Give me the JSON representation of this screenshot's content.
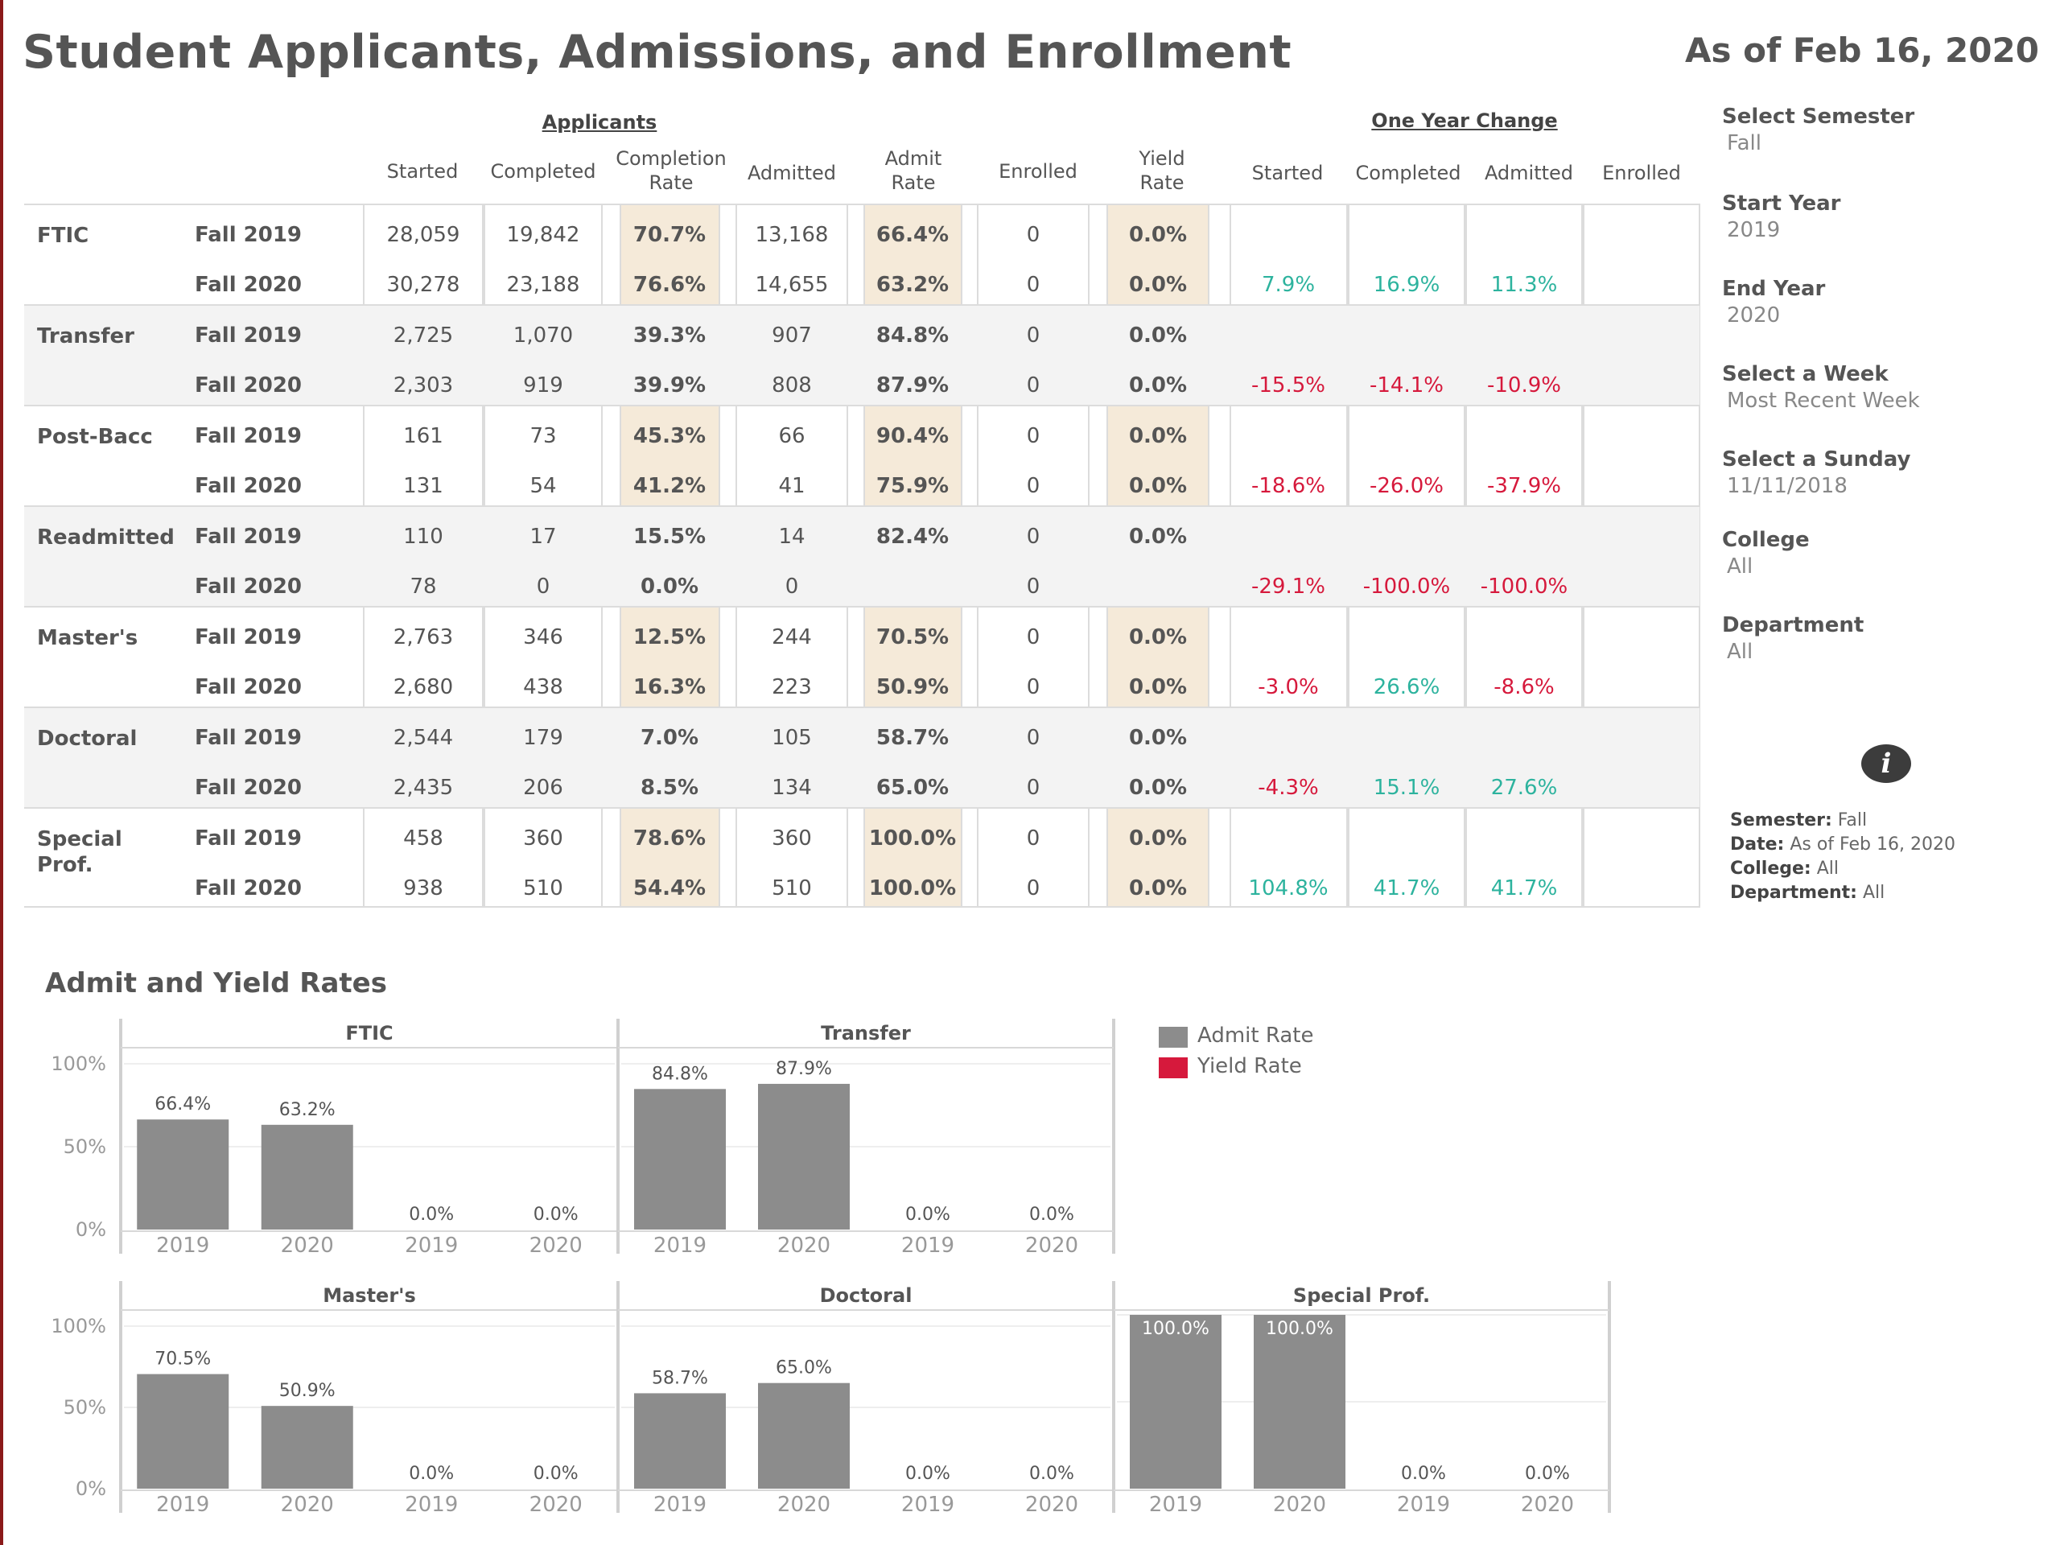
{
  "title": "Student Applicants, Admissions, and Enrollment",
  "as_of": "As of Feb 16, 2020",
  "table": {
    "group_headers": {
      "applicants": "Applicants",
      "change": "One Year Change"
    },
    "headers": {
      "started": "Started",
      "completed": "Completed",
      "completion_rate": "Completion Rate",
      "admitted": "Admitted",
      "admit_rate": "Admit Rate",
      "enrolled": "Enrolled",
      "yield_rate": "Yield Rate",
      "chg_started": "Started",
      "chg_completed": "Completed",
      "chg_admitted": "Admitted",
      "chg_enrolled": "Enrolled"
    },
    "groups": [
      {
        "name": "FTIC",
        "rows": [
          {
            "term": "Fall 2019",
            "started": "28,059",
            "completed": "19,842",
            "completion_rate": "70.7%",
            "admitted": "13,168",
            "admit_rate": "66.4%",
            "enrolled": "0",
            "yield_rate": "0.0%",
            "chg_started": "",
            "chg_completed": "",
            "chg_admitted": ""
          },
          {
            "term": "Fall 2020",
            "started": "30,278",
            "completed": "23,188",
            "completion_rate": "76.6%",
            "admitted": "14,655",
            "admit_rate": "63.2%",
            "enrolled": "0",
            "yield_rate": "0.0%",
            "chg_started": "7.9%",
            "chg_completed": "16.9%",
            "chg_admitted": "11.3%"
          }
        ]
      },
      {
        "name": "Transfer",
        "rows": [
          {
            "term": "Fall 2019",
            "started": "2,725",
            "completed": "1,070",
            "completion_rate": "39.3%",
            "admitted": "907",
            "admit_rate": "84.8%",
            "enrolled": "0",
            "yield_rate": "0.0%",
            "chg_started": "",
            "chg_completed": "",
            "chg_admitted": ""
          },
          {
            "term": "Fall 2020",
            "started": "2,303",
            "completed": "919",
            "completion_rate": "39.9%",
            "admitted": "808",
            "admit_rate": "87.9%",
            "enrolled": "0",
            "yield_rate": "0.0%",
            "chg_started": "-15.5%",
            "chg_completed": "-14.1%",
            "chg_admitted": "-10.9%"
          }
        ]
      },
      {
        "name": "Post-Bacc",
        "rows": [
          {
            "term": "Fall 2019",
            "started": "161",
            "completed": "73",
            "completion_rate": "45.3%",
            "admitted": "66",
            "admit_rate": "90.4%",
            "enrolled": "0",
            "yield_rate": "0.0%",
            "chg_started": "",
            "chg_completed": "",
            "chg_admitted": ""
          },
          {
            "term": "Fall 2020",
            "started": "131",
            "completed": "54",
            "completion_rate": "41.2%",
            "admitted": "41",
            "admit_rate": "75.9%",
            "enrolled": "0",
            "yield_rate": "0.0%",
            "chg_started": "-18.6%",
            "chg_completed": "-26.0%",
            "chg_admitted": "-37.9%"
          }
        ]
      },
      {
        "name": "Readmitted",
        "rows": [
          {
            "term": "Fall 2019",
            "started": "110",
            "completed": "17",
            "completion_rate": "15.5%",
            "admitted": "14",
            "admit_rate": "82.4%",
            "enrolled": "0",
            "yield_rate": "0.0%",
            "chg_started": "",
            "chg_completed": "",
            "chg_admitted": ""
          },
          {
            "term": "Fall 2020",
            "started": "78",
            "completed": "0",
            "completion_rate": "0.0%",
            "admitted": "0",
            "admit_rate": "",
            "enrolled": "0",
            "yield_rate": "",
            "chg_started": "-29.1%",
            "chg_completed": "-100.0%",
            "chg_admitted": "-100.0%"
          }
        ]
      },
      {
        "name": "Master's",
        "rows": [
          {
            "term": "Fall 2019",
            "started": "2,763",
            "completed": "346",
            "completion_rate": "12.5%",
            "admitted": "244",
            "admit_rate": "70.5%",
            "enrolled": "0",
            "yield_rate": "0.0%",
            "chg_started": "",
            "chg_completed": "",
            "chg_admitted": ""
          },
          {
            "term": "Fall 2020",
            "started": "2,680",
            "completed": "438",
            "completion_rate": "16.3%",
            "admitted": "223",
            "admit_rate": "50.9%",
            "enrolled": "0",
            "yield_rate": "0.0%",
            "chg_started": "-3.0%",
            "chg_completed": "26.6%",
            "chg_admitted": "-8.6%"
          }
        ]
      },
      {
        "name": "Doctoral",
        "rows": [
          {
            "term": "Fall 2019",
            "started": "2,544",
            "completed": "179",
            "completion_rate": "7.0%",
            "admitted": "105",
            "admit_rate": "58.7%",
            "enrolled": "0",
            "yield_rate": "0.0%",
            "chg_started": "",
            "chg_completed": "",
            "chg_admitted": ""
          },
          {
            "term": "Fall 2020",
            "started": "2,435",
            "completed": "206",
            "completion_rate": "8.5%",
            "admitted": "134",
            "admit_rate": "65.0%",
            "enrolled": "0",
            "yield_rate": "0.0%",
            "chg_started": "-4.3%",
            "chg_completed": "15.1%",
            "chg_admitted": "27.6%"
          }
        ]
      },
      {
        "name": "Special Prof.",
        "rows": [
          {
            "term": "Fall 2019",
            "started": "458",
            "completed": "360",
            "completion_rate": "78.6%",
            "admitted": "360",
            "admit_rate": "100.0%",
            "enrolled": "0",
            "yield_rate": "0.0%",
            "chg_started": "",
            "chg_completed": "",
            "chg_admitted": ""
          },
          {
            "term": "Fall 2020",
            "started": "938",
            "completed": "510",
            "completion_rate": "54.4%",
            "admitted": "510",
            "admit_rate": "100.0%",
            "enrolled": "0",
            "yield_rate": "0.0%",
            "chg_started": "104.8%",
            "chg_completed": "41.7%",
            "chg_admitted": "41.7%"
          }
        ]
      }
    ]
  },
  "filters": {
    "semester": {
      "label": "Select Semester",
      "value": "Fall"
    },
    "start_year": {
      "label": "Start Year",
      "value": "2019"
    },
    "end_year": {
      "label": "End Year",
      "value": "2020"
    },
    "week": {
      "label": "Select a Week",
      "value": "Most Recent Week"
    },
    "sunday": {
      "label": "Select a Sunday",
      "value": "11/11/2018"
    },
    "college": {
      "label": "College",
      "value": "All"
    },
    "department": {
      "label": "Department",
      "value": "All"
    }
  },
  "info_icon": "info-icon",
  "summary": {
    "semester_label": "Semester:",
    "semester_value": "Fall",
    "date_label": "Date:",
    "date_value": "As of Feb 16, 2020",
    "college_label": "College:",
    "college_value": "All",
    "department_label": "Department:",
    "department_value": "All"
  },
  "chart_section_title": "Admit and Yield Rates",
  "legend": [
    {
      "label": "Admit Rate",
      "color": "#8c8c8c"
    },
    {
      "label": "Yield Rate",
      "color": "#d6193c"
    }
  ],
  "chart_data": [
    {
      "type": "bar",
      "title": "FTIC",
      "categories": [
        "2019",
        "2020",
        "2019",
        "2020"
      ],
      "series": [
        {
          "name": "Admit Rate",
          "values": [
            66.4,
            63.2,
            null,
            null
          ]
        },
        {
          "name": "Yield Rate",
          "values": [
            null,
            null,
            0.0,
            0.0
          ]
        }
      ],
      "labels": [
        "66.4%",
        "63.2%",
        "0.0%",
        "0.0%"
      ],
      "yticks": [
        "100%",
        "50%",
        "0%"
      ],
      "ylim": [
        0,
        100
      ]
    },
    {
      "type": "bar",
      "title": "Transfer",
      "categories": [
        "2019",
        "2020",
        "2019",
        "2020"
      ],
      "series": [
        {
          "name": "Admit Rate",
          "values": [
            84.8,
            87.9,
            null,
            null
          ]
        },
        {
          "name": "Yield Rate",
          "values": [
            null,
            null,
            0.0,
            0.0
          ]
        }
      ],
      "labels": [
        "84.8%",
        "87.9%",
        "0.0%",
        "0.0%"
      ],
      "yticks": [
        "100%",
        "50%",
        "0%"
      ],
      "ylim": [
        0,
        100
      ]
    },
    {
      "type": "bar",
      "title": "Master's",
      "categories": [
        "2019",
        "2020",
        "2019",
        "2020"
      ],
      "series": [
        {
          "name": "Admit Rate",
          "values": [
            70.5,
            50.9,
            null,
            null
          ]
        },
        {
          "name": "Yield Rate",
          "values": [
            null,
            null,
            0.0,
            0.0
          ]
        }
      ],
      "labels": [
        "70.5%",
        "50.9%",
        "0.0%",
        "0.0%"
      ],
      "yticks": [
        "100%",
        "50%",
        "0%"
      ],
      "ylim": [
        0,
        100
      ]
    },
    {
      "type": "bar",
      "title": "Doctoral",
      "categories": [
        "2019",
        "2020",
        "2019",
        "2020"
      ],
      "series": [
        {
          "name": "Admit Rate",
          "values": [
            58.7,
            65.0,
            null,
            null
          ]
        },
        {
          "name": "Yield Rate",
          "values": [
            null,
            null,
            0.0,
            0.0
          ]
        }
      ],
      "labels": [
        "58.7%",
        "65.0%",
        "0.0%",
        "0.0%"
      ],
      "yticks": [
        "100%",
        "50%",
        "0%"
      ],
      "ylim": [
        0,
        100
      ]
    },
    {
      "type": "bar",
      "title": "Special Prof.",
      "categories": [
        "2019",
        "2020",
        "2019",
        "2020"
      ],
      "series": [
        {
          "name": "Admit Rate",
          "values": [
            100.0,
            100.0,
            null,
            null
          ]
        },
        {
          "name": "Yield Rate",
          "values": [
            null,
            null,
            0.0,
            0.0
          ]
        }
      ],
      "labels": [
        "100.0%",
        "100.0%",
        "0.0%",
        "0.0%"
      ],
      "yticks": [],
      "ylim": [
        0,
        100
      ]
    }
  ]
}
